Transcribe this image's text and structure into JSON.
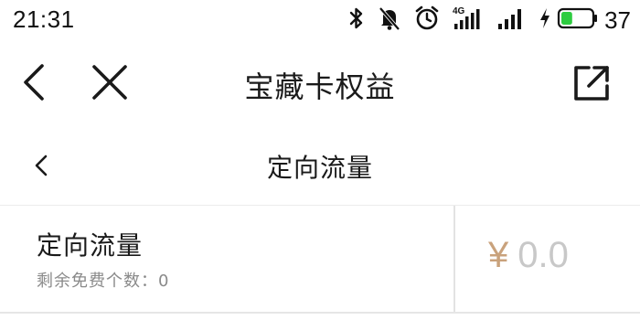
{
  "status_bar": {
    "time": "21:31",
    "network_label": "4G",
    "battery_level": "37",
    "battery_fill_percent": 37,
    "battery_color": "#2ecc40",
    "icons": [
      "bluetooth-icon",
      "notifications-muted-icon",
      "alarm-icon",
      "signal-4g-icon",
      "signal-icon",
      "charging-icon",
      "battery-icon"
    ]
  },
  "title_bar": {
    "title": "宝藏卡权益",
    "icons": [
      "back-icon",
      "close-icon",
      "share-icon"
    ]
  },
  "sub_header": {
    "title": "定向流量",
    "back_icon": "chevron-left-icon"
  },
  "card": {
    "name": "定向流量",
    "remaining": "剩余免费个数：0",
    "currency": "¥",
    "amount": "0.0",
    "currency_color": "#c9a27c",
    "amount_color": "#c8c8c8"
  }
}
